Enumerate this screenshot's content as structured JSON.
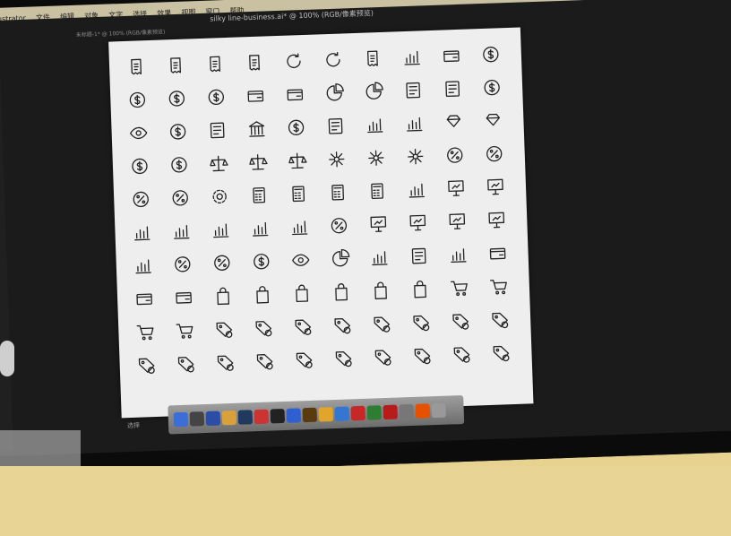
{
  "menubar": {
    "items": [
      "Illustrator",
      "文件",
      "编辑",
      "对象",
      "文字",
      "选择",
      "效果",
      "视图",
      "窗口",
      "帮助"
    ]
  },
  "document": {
    "title": "silky line-business.ai* @ 100% (RGB/像素预览)",
    "tab_label": "未标题-1* @ 100% (RGB/像素预览)"
  },
  "status_bar": {
    "label": "选择"
  },
  "icons": [
    "yen-receipt-icon",
    "euro-receipt-icon",
    "pound-receipt-icon",
    "dollar-receipt-icon",
    "refresh-icon",
    "rotate-icon",
    "receipt-icon",
    "line-chart-icon",
    "cards-icon",
    "dollar-coins-icon",
    "euro-coins-icon",
    "pound-coins-icon",
    "yen-coins-icon",
    "wallet-icon",
    "wallet-open-icon",
    "pie-chart-icon",
    "pie-chart-2-icon",
    "person-money-icon",
    "people-money-icon",
    "target-dollar-icon",
    "eye-icon",
    "dollar-search-icon",
    "invoice-icon",
    "bank-icon",
    "dollar-coin-icon",
    "safe-icon",
    "growth-chart-icon",
    "decline-chart-icon",
    "hand-gem-icon",
    "hand-diamond-icon",
    "shield-dollar-icon",
    "idea-dollar-icon",
    "scales-icon",
    "gavel-icon",
    "scale-weight-icon",
    "network-icon",
    "network-user-icon",
    "question-network-icon",
    "percent-icon",
    "percent-circle-icon",
    "percent-badge-icon",
    "percent-badge-2-icon",
    "settings-gear-icon",
    "calculator-icon",
    "calculator-2-icon",
    "calculator-3-icon",
    "abacus-icon",
    "line-graph-icon",
    "presentation-bar-icon",
    "presentation-org-icon",
    "bar-chart-icon",
    "table-chart-icon",
    "area-chart-icon",
    "bars-icon",
    "bars-line-icon",
    "percent-small-icon",
    "presentation-line-icon",
    "presentation-search-icon",
    "presentation-board-icon",
    "presentation-pie-icon",
    "org-chart-icon",
    "percent-frame-icon",
    "percent-dots-icon",
    "dollar-dashed-icon",
    "eye-dashed-icon",
    "pie-dashed-icon",
    "bars-dashed-icon",
    "chat-dashed-icon",
    "chart-dashed-icon",
    "card-remove-icon",
    "card-receipt-icon",
    "card-remove-2-icon",
    "bag-icon",
    "bag-minus-icon",
    "bag-plus-icon",
    "bag-x-icon",
    "bag-check-icon",
    "bag-download-icon",
    "cart-icon",
    "cart-plus-icon",
    "cart-remove-icon",
    "cart-x-icon",
    "tag-icon",
    "tags-icon",
    "tag-check-icon",
    "tag-x-icon",
    "tag-ban-icon",
    "tag-search-icon",
    "tag-edit-icon",
    "tag-warning-icon",
    "tag-refresh-icon",
    "tag-heart-icon",
    "tag-star-icon",
    "tag-plus-icon",
    "tag-share-icon",
    "tag-gear-icon",
    "tag-lock-icon",
    "tag-minus-icon",
    "tag-download-icon",
    "tag-upload-icon"
  ],
  "dock": {
    "apps": [
      {
        "icon": "finder-icon",
        "color": "#3b6fd6"
      },
      {
        "icon": "launchpad-icon",
        "color": "#444"
      },
      {
        "icon": "s-app-icon",
        "color": "#2a4da8"
      },
      {
        "icon": "chrome-icon",
        "color": "#d9a13b"
      },
      {
        "icon": "photoshop-icon",
        "color": "#1f3a5c"
      },
      {
        "icon": "translate-icon",
        "color": "#c33"
      },
      {
        "icon": "terminal-icon",
        "color": "#222"
      },
      {
        "icon": "media-icon",
        "color": "#2f5fd0"
      },
      {
        "icon": "illustrator-icon",
        "color": "#5a3b10"
      },
      {
        "icon": "sketch-icon",
        "color": "#e0a52a"
      },
      {
        "icon": "pinwheel-icon",
        "color": "#3576d0"
      },
      {
        "icon": "pinterest-icon",
        "color": "#c62828"
      },
      {
        "icon": "chrome-2-icon",
        "color": "#2e7d32"
      },
      {
        "icon": "filezilla-icon",
        "color": "#b71c1c"
      },
      {
        "icon": "preview-icon",
        "color": "#777"
      },
      {
        "icon": "firefox-icon",
        "color": "#e65100"
      },
      {
        "icon": "trash-icon",
        "color": "#999"
      }
    ]
  }
}
